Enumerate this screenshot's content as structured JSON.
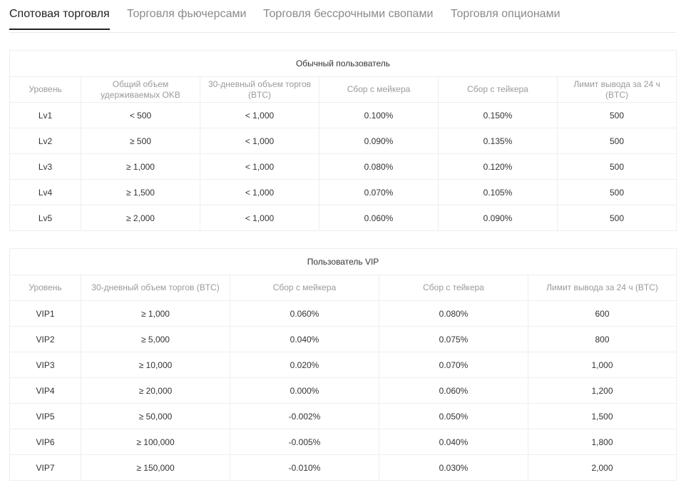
{
  "tabs": [
    {
      "label": "Спотовая торговля",
      "active": true
    },
    {
      "label": "Торговля фьючерсами",
      "active": false
    },
    {
      "label": "Торговля бессрочными свопами",
      "active": false
    },
    {
      "label": "Торговля опционами",
      "active": false
    }
  ],
  "regular": {
    "title": "Обычный пользователь",
    "columns": [
      "Уровень",
      "Общий объем удерживаемых OKB",
      "30-дневный объем торгов (BTC)",
      "Сбор с мейкера",
      "Сбор с тейкера",
      "Лимит вывода за 24 ч (BTC)"
    ],
    "rows": [
      [
        "Lv1",
        "< 500",
        "< 1,000",
        "0.100%",
        "0.150%",
        "500"
      ],
      [
        "Lv2",
        "≥ 500",
        "< 1,000",
        "0.090%",
        "0.135%",
        "500"
      ],
      [
        "Lv3",
        "≥ 1,000",
        "< 1,000",
        "0.080%",
        "0.120%",
        "500"
      ],
      [
        "Lv4",
        "≥ 1,500",
        "< 1,000",
        "0.070%",
        "0.105%",
        "500"
      ],
      [
        "Lv5",
        "≥ 2,000",
        "< 1,000",
        "0.060%",
        "0.090%",
        "500"
      ]
    ]
  },
  "vip": {
    "title": "Пользователь VIP",
    "columns": [
      "Уровень",
      "30-дневный объем торгов (BTC)",
      "Сбор с мейкера",
      "Сбор с тейкера",
      "Лимит вывода за 24 ч (BTC)"
    ],
    "rows": [
      [
        "VIP1",
        "≥ 1,000",
        "0.060%",
        "0.080%",
        "600"
      ],
      [
        "VIP2",
        "≥ 5,000",
        "0.040%",
        "0.075%",
        "800"
      ],
      [
        "VIP3",
        "≥ 10,000",
        "0.020%",
        "0.070%",
        "1,000"
      ],
      [
        "VIP4",
        "≥ 20,000",
        "0.000%",
        "0.060%",
        "1,200"
      ],
      [
        "VIP5",
        "≥ 50,000",
        "-0.002%",
        "0.050%",
        "1,500"
      ],
      [
        "VIP6",
        "≥ 100,000",
        "-0.005%",
        "0.040%",
        "1,800"
      ],
      [
        "VIP7",
        "≥ 150,000",
        "-0.010%",
        "0.030%",
        "2,000"
      ]
    ]
  }
}
